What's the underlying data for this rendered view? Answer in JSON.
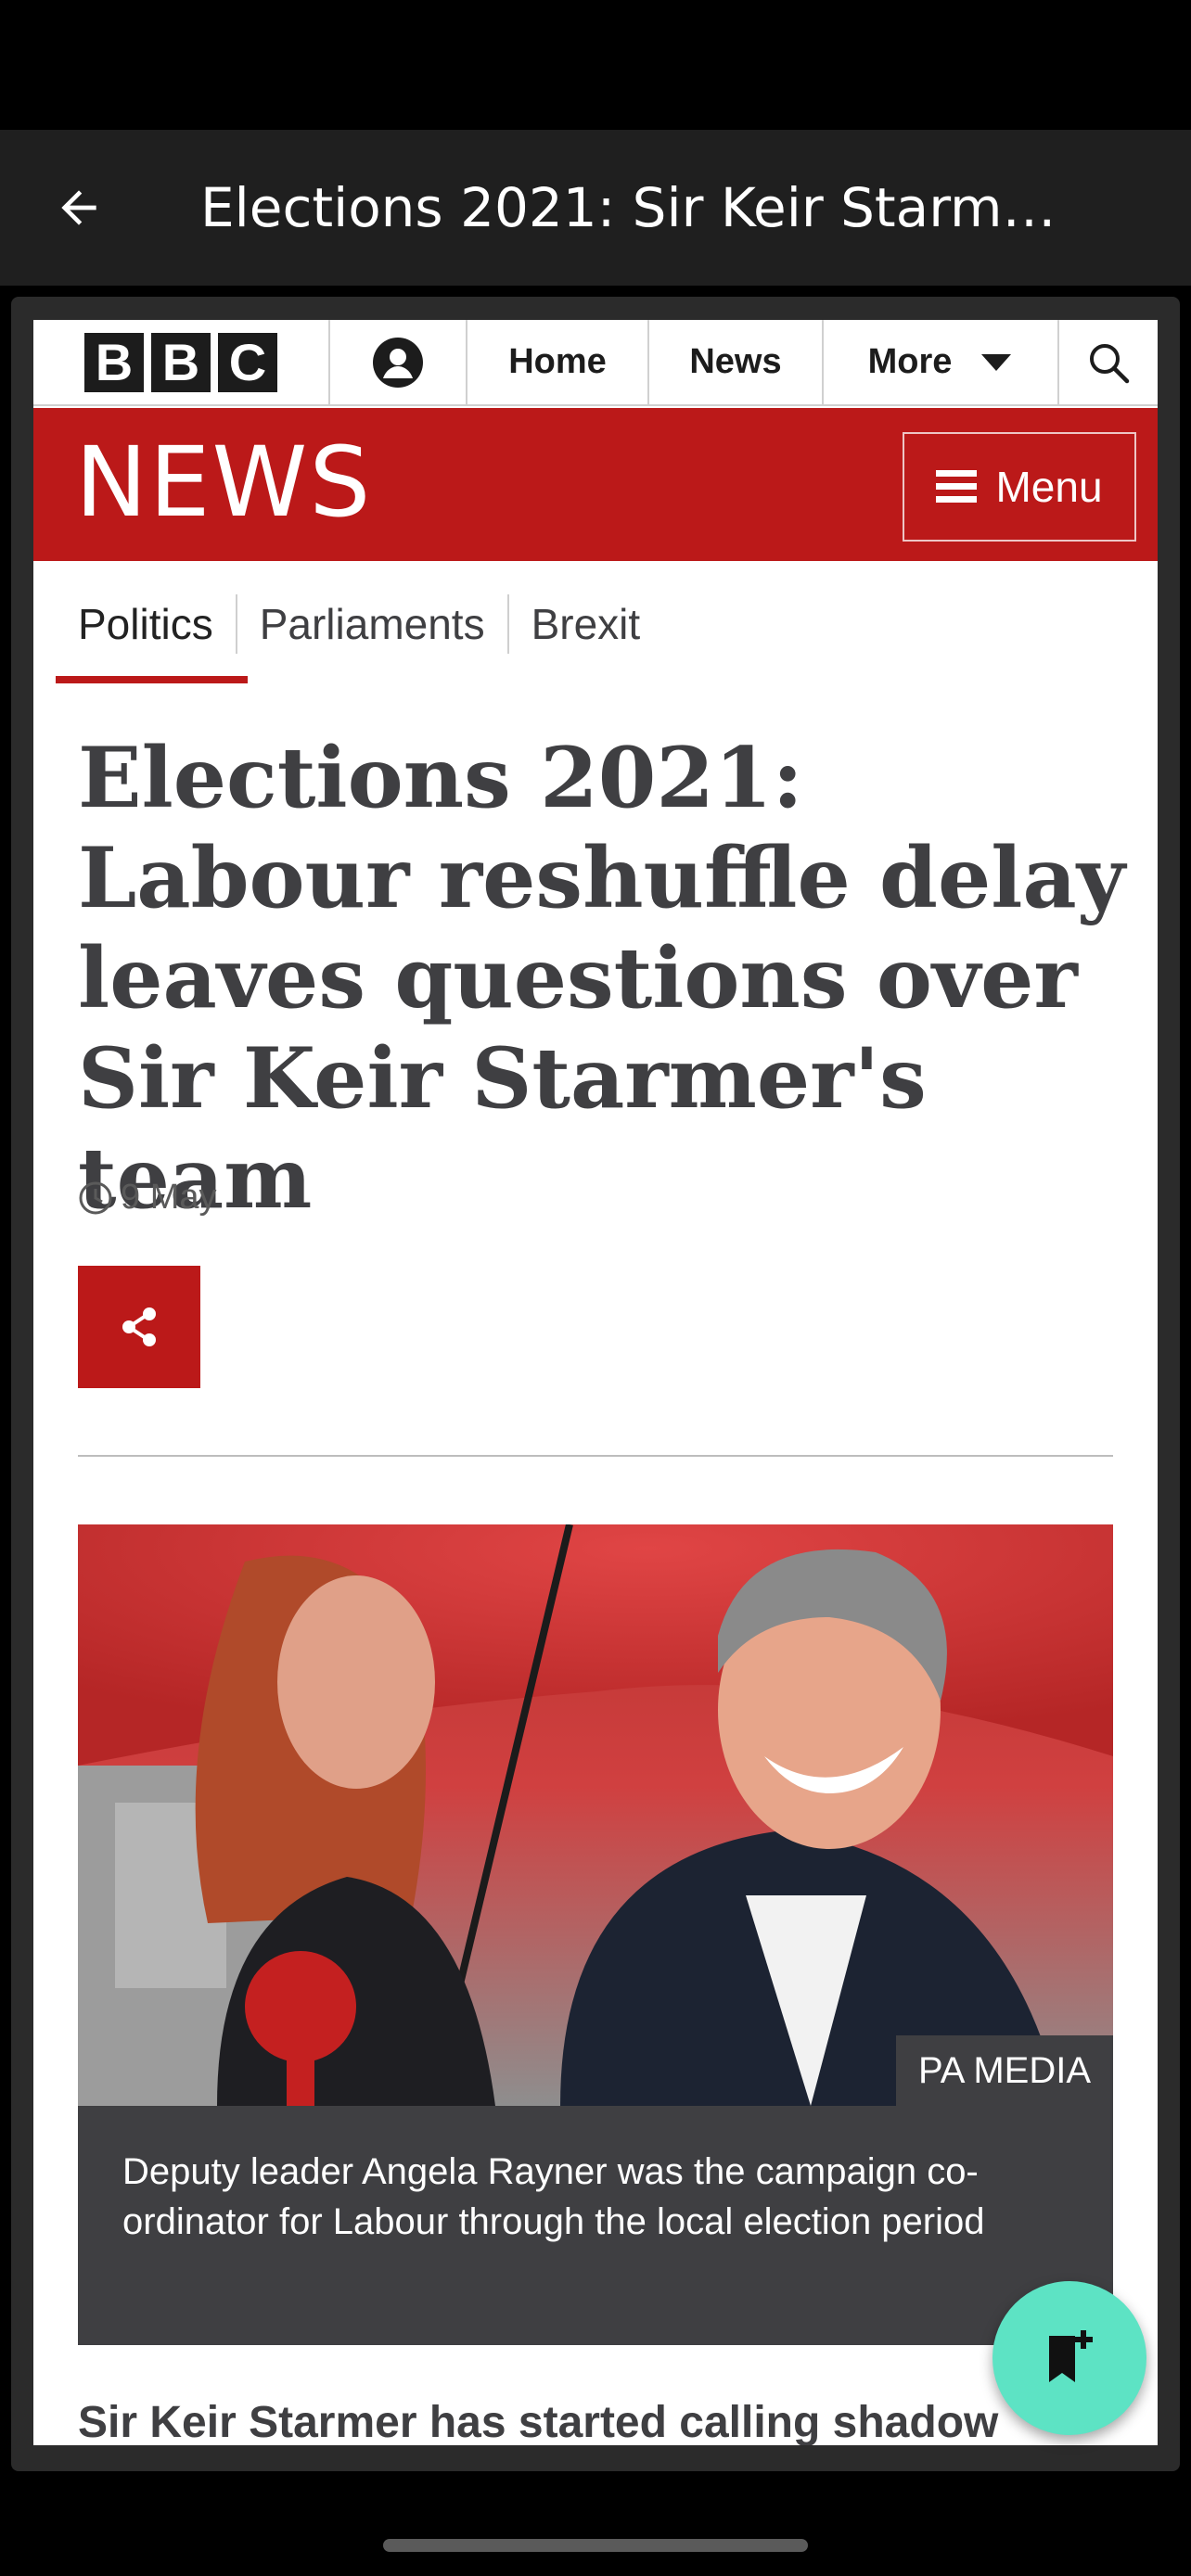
{
  "app_bar": {
    "title": "Elections 2021: Sir Keir Starmer ..."
  },
  "bbc_bar": {
    "logo_letters": [
      "B",
      "B",
      "C"
    ],
    "nav": {
      "home": "Home",
      "news": "News",
      "more": "More"
    }
  },
  "banner": {
    "wordmark": "NEWS",
    "menu_label": "Menu"
  },
  "subnav": {
    "items": [
      "Politics",
      "Parliaments",
      "Brexit"
    ],
    "active": "Politics"
  },
  "article": {
    "headline": "Elections 2021: Labour reshuffle delay leaves questions over Sir Keir Starmer's team",
    "date": "9 May",
    "image_credit": "PA MEDIA",
    "caption": "Deputy leader Angela Rayner was the campaign co-ordinator for Labour through the local election period",
    "body_first_line": "Sir Keir Starmer has started calling shadow"
  },
  "colors": {
    "bbc_red": "#bb1919",
    "fab": "#5de3c4",
    "app_bar": "#1f1f1f"
  },
  "icons": {
    "back": "arrow-left-icon",
    "account": "account-icon",
    "more": "caret-down-icon",
    "search": "search-icon",
    "menu": "hamburger-icon",
    "clock": "clock-icon",
    "share": "share-icon",
    "fab": "bookmark-add-icon"
  }
}
